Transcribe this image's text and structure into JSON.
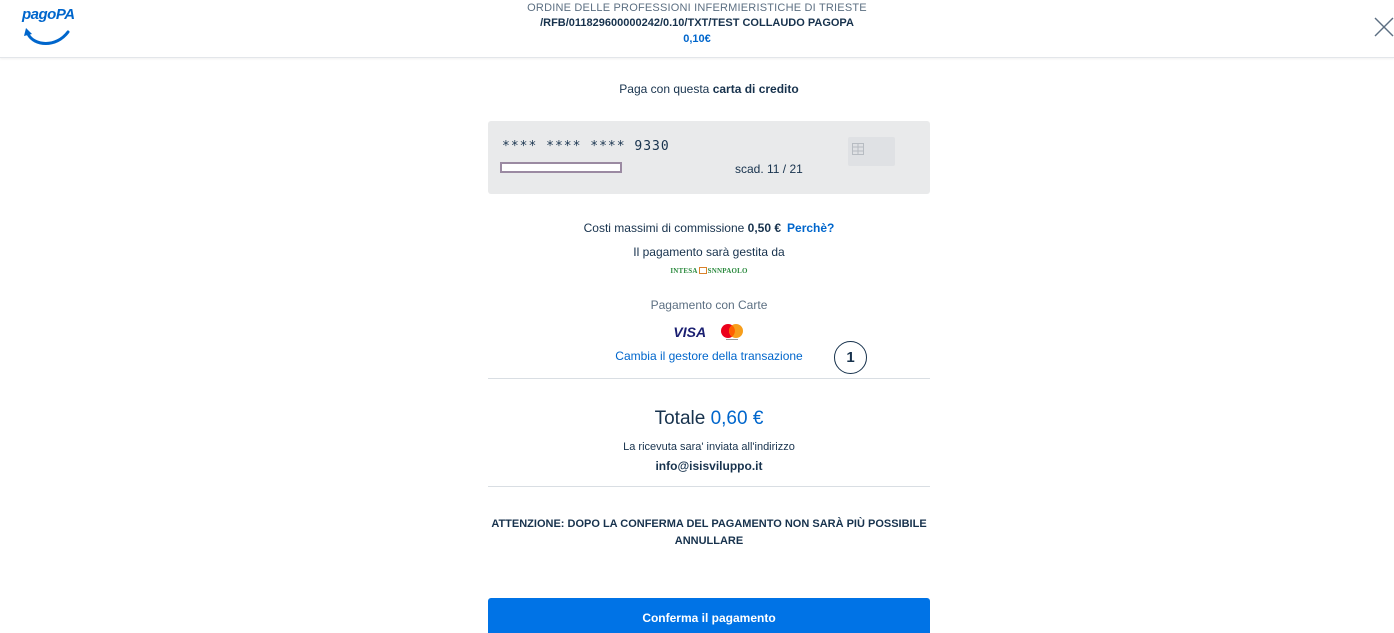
{
  "header": {
    "logo_text": "pagoPA",
    "org_name": "ORDINE DELLE PROFESSIONI INFERMIERISTICHE DI TRIESTE",
    "causale": "/RFB/011829600000242/0.10/TXT/TEST COLLAUDO PAGOPA",
    "amount": "0,10€"
  },
  "payment": {
    "intro_prefix": "Paga con questa ",
    "intro_bold": "carta di credito"
  },
  "card": {
    "number": "**** **** **** 9330",
    "expiry": "scad. 11 / 21"
  },
  "fees": {
    "label": "Costi massimi di commissione ",
    "amount": "0,50 €",
    "why_link": "Perchè?",
    "managed_by": "Il pagamento sarà gestita da",
    "psp_left": "INTESA",
    "psp_right": "SNNPAOLO",
    "pay_cards": "Pagamento con Carte",
    "visa": "VISA",
    "change_link": "Cambia il gestore della transazione",
    "badge": "1"
  },
  "summary": {
    "total_label": "Totale ",
    "total_amount": "0,60 €",
    "receipt_text": "La ricevuta sara' inviata all'indirizzo",
    "email": "info@isisviluppo.it",
    "warning": "ATTENZIONE: DOPO LA CONFERMA DEL PAGAMENTO NON SARÀ PIÙ POSSIBILE ANNULLARE"
  },
  "actions": {
    "confirm_label": "Conferma il pagamento"
  },
  "colors": {
    "accent": "#0066cc",
    "button": "#0073e6",
    "text": "#17324d"
  },
  "icons": [
    "pagopa-logo",
    "close-icon",
    "chip-icon",
    "mastercard-icon"
  ]
}
